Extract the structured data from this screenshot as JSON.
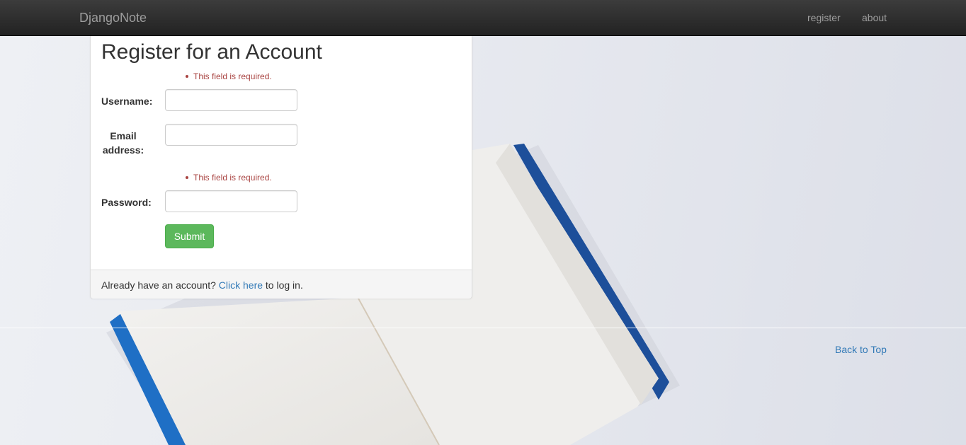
{
  "navbar": {
    "brand": "DjangoNote",
    "links": [
      "register",
      "about"
    ]
  },
  "form": {
    "title": "Register for an Account",
    "username_error": "This field is required.",
    "username_label": "Username:",
    "email_label_line1": "Email",
    "email_label_line2": "address:",
    "password_error": "This field is required.",
    "password_label": "Password:",
    "username_value": "",
    "email_value": "",
    "password_value": "",
    "submit_label": "Submit"
  },
  "footer": {
    "prefix": "Already have an account?",
    "link_text": "Click here",
    "suffix": "to log in."
  },
  "page": {
    "back_to_top": "Back to Top"
  },
  "colors": {
    "navbar_bg": "#222222",
    "submit_green": "#5cb85c",
    "error_red": "#a94442",
    "link_blue": "#337ab7"
  }
}
